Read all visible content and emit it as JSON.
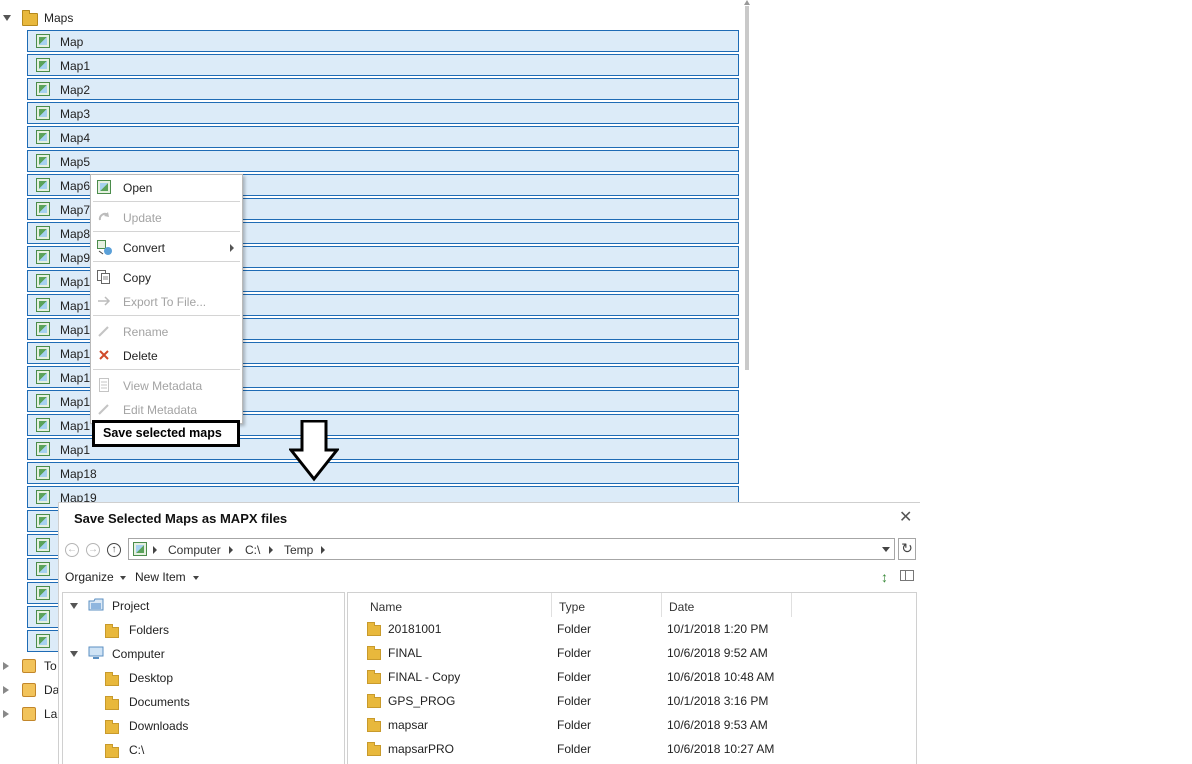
{
  "tree": {
    "root_label": "Maps",
    "maps": [
      "Map",
      "Map1",
      "Map2",
      "Map3",
      "Map4",
      "Map5",
      "Map6",
      "Map7",
      "Map8",
      "Map9",
      "Map1",
      "Map1",
      "Map1",
      "Map1",
      "Map1",
      "Map1",
      "Map1",
      "Map1",
      "Map18",
      "Map19"
    ],
    "bottom_items": [
      "To",
      "Da",
      "La"
    ]
  },
  "context_menu": {
    "items": [
      {
        "label": "Open",
        "icon": "map-icon",
        "enabled": true
      },
      {
        "label": "Update",
        "icon": "update-icon",
        "enabled": false
      },
      {
        "label": "Convert",
        "icon": "convert-icon",
        "enabled": true,
        "submenu": true
      },
      {
        "label": "Copy",
        "icon": "copy-icon",
        "enabled": true
      },
      {
        "label": "Export To File...",
        "icon": "export-arrow-icon",
        "enabled": false
      },
      {
        "label": "Rename",
        "icon": "pencil-icon",
        "enabled": false
      },
      {
        "label": "Delete",
        "icon": "delete-x-icon",
        "enabled": true
      },
      {
        "label": "View Metadata",
        "icon": "metadata-icon",
        "enabled": false
      },
      {
        "label": "Edit Metadata",
        "icon": "pencil-icon",
        "enabled": false
      }
    ],
    "highlight_label": "Save selected maps"
  },
  "dialog": {
    "title": "Save Selected Maps as MAPX files",
    "breadcrumb": [
      "Computer",
      "C:\\",
      "Temp"
    ],
    "toolbar": {
      "organize": "Organize",
      "new_item": "New Item"
    },
    "nav": [
      {
        "label": "Project",
        "expanded": true,
        "level": 0,
        "icon": "project-folder-icon"
      },
      {
        "label": "Folders",
        "level": 1,
        "icon": "folder-icon"
      },
      {
        "label": "Computer",
        "expanded": true,
        "level": 0,
        "icon": "computer-icon"
      },
      {
        "label": "Desktop",
        "level": 1,
        "icon": "folder-icon"
      },
      {
        "label": "Documents",
        "level": 1,
        "icon": "folder-icon"
      },
      {
        "label": "Downloads",
        "level": 1,
        "icon": "folder-icon"
      },
      {
        "label": "C:\\",
        "level": 1,
        "icon": "folder-icon"
      }
    ],
    "columns": {
      "name": "Name",
      "type": "Type",
      "date": "Date"
    },
    "files": [
      {
        "name": "20181001",
        "type": "Folder",
        "date": "10/1/2018 1:20 PM"
      },
      {
        "name": "FINAL",
        "type": "Folder",
        "date": "10/6/2018 9:52 AM"
      },
      {
        "name": "FINAL - Copy",
        "type": "Folder",
        "date": "10/6/2018 10:48 AM"
      },
      {
        "name": "GPS_PROG",
        "type": "Folder",
        "date": "10/1/2018 3:16 PM"
      },
      {
        "name": "mapsar",
        "type": "Folder",
        "date": "10/6/2018 9:53 AM"
      },
      {
        "name": "mapsarPRO",
        "type": "Folder",
        "date": "10/6/2018 10:27 AM"
      }
    ]
  },
  "colors": {
    "selection": "#dcebf8",
    "selection_border": "#1e6bb5",
    "folder": "#e8b83c"
  }
}
